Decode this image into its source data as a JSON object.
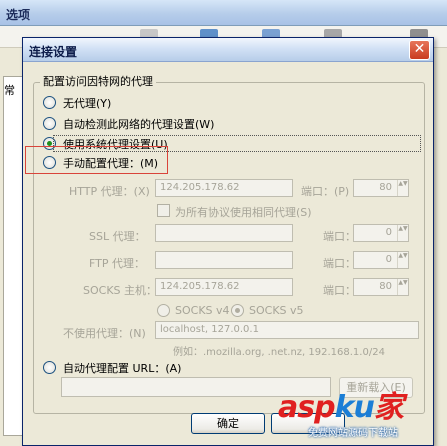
{
  "background_window": {
    "title": "选项",
    "left_tab": "常"
  },
  "dialog": {
    "title": "连接设置",
    "close_glyph": "✕",
    "group_title": "配置访问因特网的代理",
    "options": {
      "no_proxy": "无代理(Y)",
      "auto_detect": "自动检测此网络的代理设置(W)",
      "system_proxy": "使用系统代理设置(U)",
      "manual_proxy": "手动配置代理：(M)"
    },
    "http": {
      "label": "HTTP 代理：(X)",
      "value": "124.205.178.62",
      "port_label": "端口：(P)",
      "port_value": "80"
    },
    "same_proxy_checkbox": "为所有协议使用相同代理(S)",
    "ssl": {
      "label": "SSL 代理：",
      "value": "",
      "port_label": "端口：",
      "port_value": "0"
    },
    "ftp": {
      "label": "FTP 代理：",
      "value": "",
      "port_label": "端口：",
      "port_value": "0"
    },
    "socks": {
      "label": "SOCKS 主机：",
      "value": "124.205.178.62",
      "port_label": "端口：",
      "port_value": "80"
    },
    "socks_v4": "SOCKS v4",
    "socks_v5": "SOCKS v5",
    "no_proxy_for": {
      "label": "不使用代理：(N)",
      "value": "localhost, 127.0.0.1"
    },
    "example": "例如：.mozilla.org, .net.nz, 192.168.1.0/24",
    "auto_config": {
      "label": "自动代理配置 URL：(A)",
      "value": ""
    },
    "reload_button": "重新载入(E)",
    "ok_button": "确定",
    "selected_option": "system_proxy",
    "spin_arrows": "▲▼"
  },
  "watermark": {
    "logo_part1": "asp",
    "logo_part2": "ku",
    "logo_part3": "家",
    "subtitle": "免费网站源码下载站"
  },
  "colors": {
    "accent_highlight": "#d9443a",
    "title_blue": "#0d1c4a",
    "radio_green": "#1f8e1f"
  }
}
